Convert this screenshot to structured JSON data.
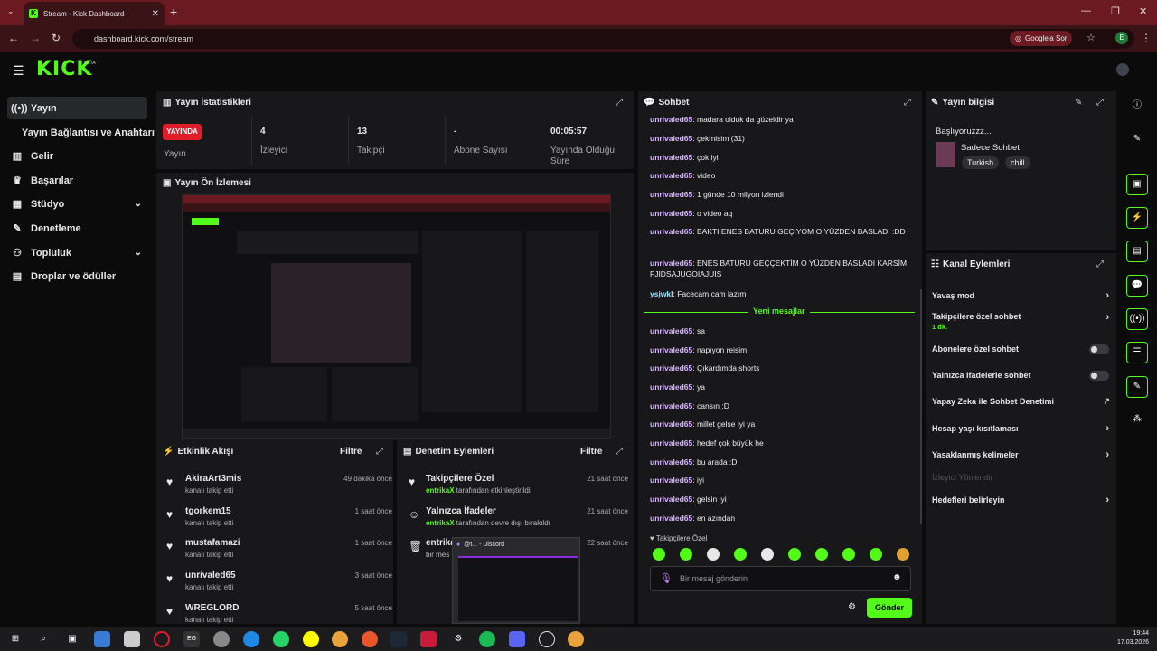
{
  "browser": {
    "tab_title": "Stream - Kick Dashboard",
    "url": "dashboard.kick.com/stream",
    "google_btn": "Google'a Sor",
    "profile_initial": "E"
  },
  "brand": {
    "logo": "KICK",
    "beta": "BETA",
    "accent": "#53fc18"
  },
  "sidebar": {
    "items": [
      {
        "label": "Yayın",
        "icon": "broadcast-icon"
      },
      {
        "label": "Yayın Bağlantısı ve Anahtarı"
      },
      {
        "label": "Gelir",
        "icon": "chart-icon"
      },
      {
        "label": "Başarılar",
        "icon": "trophy-icon"
      },
      {
        "label": "Stüdyo",
        "icon": "grid-icon"
      },
      {
        "label": "Denetleme",
        "icon": "wrench-icon"
      },
      {
        "label": "Topluluk",
        "icon": "group-icon"
      },
      {
        "label": "Droplar ve ödüller",
        "icon": "dashboard-icon"
      }
    ]
  },
  "stats": {
    "title": "Yayın İstatistikleri",
    "live_badge": "YAYINDA",
    "live_label": "Yayın",
    "items": [
      {
        "value": "4",
        "label": "İzleyici"
      },
      {
        "value": "13",
        "label": "Takipçi"
      },
      {
        "value": "-",
        "label": "Abone Sayısı"
      },
      {
        "value": "00:05:57",
        "label": "Yayında Olduğu Süre"
      }
    ]
  },
  "preview": {
    "title": "Yayın Ön İzlemesi"
  },
  "activity": {
    "title": "Etkinlik Akışı",
    "filter": "Filtre",
    "items": [
      {
        "name": "AkiraArt3mis",
        "sub": "kanalı takip etti",
        "time": "49 dakika önce"
      },
      {
        "name": "tgorkem15",
        "sub": "kanalı takip etti",
        "time": "1 saat önce"
      },
      {
        "name": "mustafamazi",
        "sub": "kanalı takip etti",
        "time": "1 saat önce"
      },
      {
        "name": "unrivaled65",
        "sub": "kanalı takip etti",
        "time": "3 saat önce"
      },
      {
        "name": "WREGLORD",
        "sub": "kanalı takip etti",
        "time": "5 saat önce"
      }
    ]
  },
  "mod_actions": {
    "title": "Denetim Eylemleri",
    "filter": "Filtre",
    "items": [
      {
        "name": "Takipçilere Özel",
        "user": "entrikaX",
        "sub": " tarafından etkinleştirildi",
        "time": "21 saat önce"
      },
      {
        "name": "Yalnızca İfadeler",
        "user": "entrikaX",
        "sub": " tarafından devre dışı bırakıldı",
        "time": "21 saat önce"
      },
      {
        "name": "entrika",
        "user": "",
        "sub": "bir mes",
        "time": "22 saat önce"
      }
    ]
  },
  "discord_popup": {
    "title": "@t... - Discord"
  },
  "chat": {
    "title": "Sohbet",
    "messages_before": [
      {
        "user": "unrivaled65",
        "text": "madara olduk da güzeldir ya"
      },
      {
        "user": "unrivaled65",
        "text": "çekmisim (31)"
      },
      {
        "user": "unrivaled65",
        "text": "çok iyi"
      },
      {
        "user": "unrivaled65",
        "text": "video"
      },
      {
        "user": "unrivaled65",
        "text": "1 günde 10 milyon izlendi"
      },
      {
        "user": "unrivaled65",
        "text": "o video aq"
      },
      {
        "user": "unrivaled65",
        "text": "BAKTI ENES BATURU GEÇİYOM O YÜZDEN BASLADI :DD"
      },
      {
        "user": "unrivaled65",
        "text": "ENES BATURU GEÇÇEKTİM O YÜZDEN BASLADI KARSİM FJIDSAJUGOIAJUIS"
      },
      {
        "user": "ysjwkl",
        "text": "Facecam cam lazım"
      }
    ],
    "new_messages": "Yeni mesajlar",
    "messages_after": [
      {
        "user": "unrivaled65",
        "text": "sa"
      },
      {
        "user": "unrivaled65",
        "text": "napıyon reisim"
      },
      {
        "user": "unrivaled65",
        "text": "Çıkardımda shorts"
      },
      {
        "user": "unrivaled65",
        "text": "ya"
      },
      {
        "user": "unrivaled65",
        "text": "cansın :D"
      },
      {
        "user": "unrivaled65",
        "text": "millet gelse iyi ya"
      },
      {
        "user": "unrivaled65",
        "text": "hedef çok büyük he"
      },
      {
        "user": "unrivaled65",
        "text": "bu arada :D"
      },
      {
        "user": "unrivaled65",
        "text": "iyi"
      },
      {
        "user": "unrivaled65",
        "text": "gelsin iyi"
      },
      {
        "user": "unrivaled65",
        "text": "en azından"
      }
    ],
    "followers_only": "Takipçilere Özel",
    "input_placeholder": "Bir mesaj gönderin",
    "send": "Gönder"
  },
  "stream_info": {
    "title": "Yayın bilgisi",
    "stream_title": "Başlıyoruzzz...",
    "category": "Sadece Sohbet",
    "tags": [
      "Turkish",
      "chill"
    ]
  },
  "channel_actions": {
    "title": "Kanal Eylemleri",
    "items": [
      {
        "label": "Yavaş mod",
        "kind": "chev"
      },
      {
        "label": "Takipçilere özel sohbet",
        "sub": "1 dk.",
        "kind": "chev"
      },
      {
        "label": "Abonelere özel sohbet",
        "kind": "toggle"
      },
      {
        "label": "Yalnızca ifadelerle sohbet",
        "kind": "toggle"
      },
      {
        "label": "Yapay Zeka ile Sohbet Denetimi",
        "kind": "ext"
      },
      {
        "label": "Hesap yaşı kısıtlaması",
        "kind": "chev"
      },
      {
        "label": "Yasaklanmış kelimeler",
        "kind": "chev"
      },
      {
        "label": "İzleyici Yönlendir",
        "kind": "disabled"
      },
      {
        "label": "Hedefleri belirleyin",
        "kind": "chev"
      }
    ]
  },
  "taskbar": {
    "time": "19:44",
    "date": "17.03.2026"
  }
}
